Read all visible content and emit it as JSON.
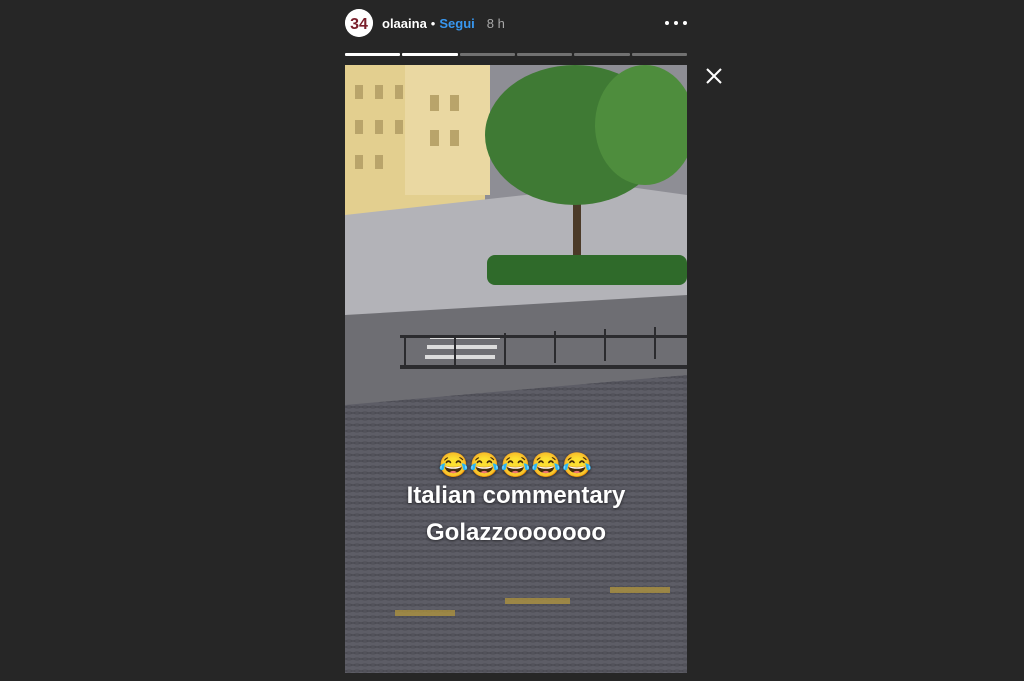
{
  "header": {
    "username": "olaaina",
    "dot": "•",
    "follow_label": "Segui",
    "time": "8 h",
    "avatar_text": "34"
  },
  "progress": {
    "total": 6,
    "active_index": 1
  },
  "story": {
    "emoji": "😂😂😂😂😂",
    "caption_line1": "Italian commentary",
    "caption_line2": "Golazzooooooo"
  },
  "colors": {
    "background": "#262626",
    "follow": "#3897f0",
    "avatar_text": "#7a1f2b"
  },
  "icons": [
    "more-options-icon",
    "close-icon"
  ]
}
